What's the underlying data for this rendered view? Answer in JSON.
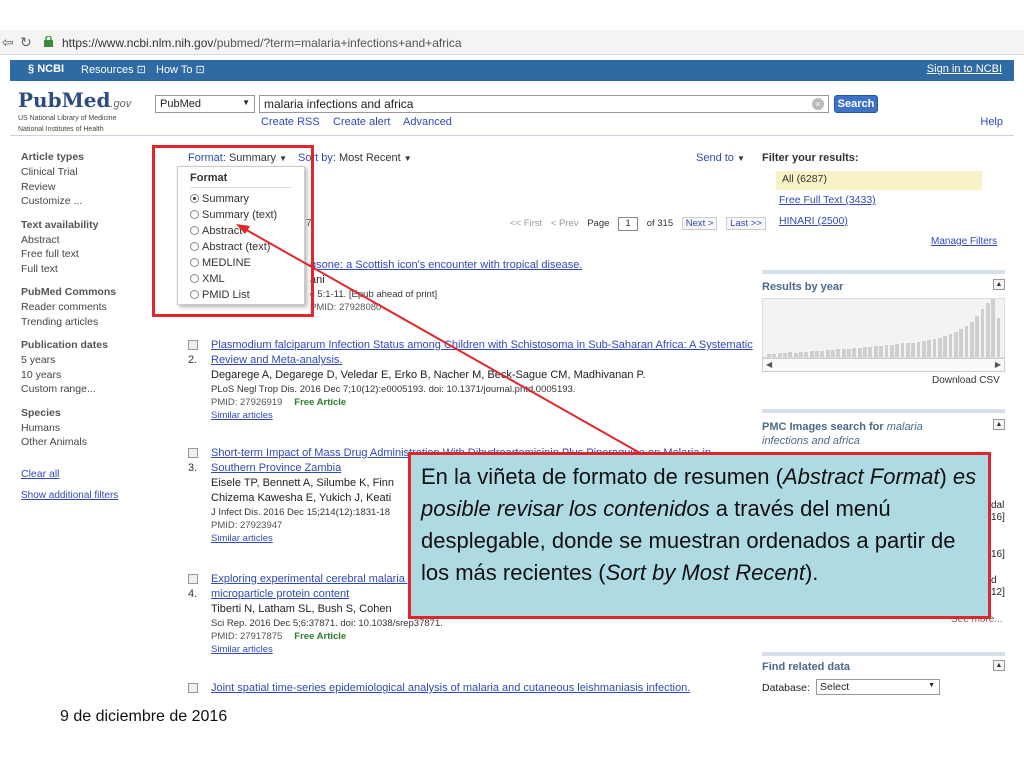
{
  "browser": {
    "url_host": "https://www.ncbi.nlm.nih.gov",
    "url_path": "/pubmed/?term=malaria+infections+and+africa"
  },
  "ncbi_bar": {
    "logo": "NCBI",
    "resources": "Resources",
    "howto": "How To",
    "signin": "Sign in to NCBI"
  },
  "header": {
    "logo_pub": "Pub",
    "logo_med": "Med",
    "logo_gov": ".gov",
    "logo_sub1": "US National Library of Medicine",
    "logo_sub2": "National Institutes of Health",
    "db": "PubMed",
    "query": "malaria infections and africa",
    "search": "Search",
    "create_rss": "Create RSS",
    "create_alert": "Create alert",
    "advanced": "Advanced",
    "help": "Help"
  },
  "sidebar": {
    "groups": [
      {
        "heading": "Article types",
        "items": [
          "Clinical Trial",
          "Review",
          "Customize ..."
        ]
      },
      {
        "heading": "Text availability",
        "items": [
          "Abstract",
          "Free full text",
          "Full text"
        ]
      },
      {
        "heading": "PubMed Commons",
        "items": [
          "Reader comments",
          "Trending articles"
        ]
      },
      {
        "heading": "Publication dates",
        "items": [
          "5 years",
          "10 years",
          "Custom range..."
        ]
      },
      {
        "heading": "Species",
        "items": [
          "Humans",
          "Other Animals"
        ]
      }
    ],
    "clear_all": "Clear all",
    "show_filters": "Show additional filters"
  },
  "toolbar": {
    "format_label": "Format:",
    "format_value": "Summary",
    "sort_label": "Sort by:",
    "sort_value": "Most Recent",
    "send_to": "Send to"
  },
  "format_menu": {
    "heading": "Format",
    "options": [
      "Summary",
      "Summary (text)",
      "Abstract",
      "Abstract (text)",
      "MEDLINE",
      "XML",
      "PMID List"
    ],
    "selected": "Summary"
  },
  "pager": {
    "first": "<< First",
    "prev": "< Prev",
    "page_label": "Page",
    "page": "1",
    "of": "of 315",
    "next": "Next >",
    "last": "Last >>",
    "items_partial": "7"
  },
  "results": [
    {
      "num": "",
      "title": "gsone: a Scottish icon's encounter with tropical disease.",
      "authors": "ani",
      "cite": "c 5:1-11. [Epub ahead of print]",
      "pmid": "PMID: 27928080",
      "free": "",
      "similar": ""
    },
    {
      "num": "2.",
      "title": "Plasmodium falciparum Infection Status among Children with Schistosoma in Sub-Saharan Africa: A Systematic Review and Meta-analysis.",
      "authors": "Degarege A, Degarege D, Veledar E, Erko B, Nacher M, Beck-Sague CM, Madhivanan P.",
      "cite": "PLoS Negl Trop Dis. 2016 Dec 7;10(12):e0005193. doi: 10.1371/journal.pntd.0005193.",
      "pmid": "PMID: 27926919",
      "free": "Free Article",
      "similar": "Similar articles"
    },
    {
      "num": "3.",
      "title": "Short-term Impact of Mass Drug Administration With Dihydroartemisinin Plus Piperaquine on Malaria in Southern Province Zambia",
      "authors": "Eisele TP, Bennett A, Silumbe K, Finn",
      "authors2": "Chizema Kawesha E, Yukich J, Keati",
      "cite": "J Infect Dis. 2016 Dec 15;214(12):1831-18",
      "pmid": "PMID: 27923947",
      "free": "",
      "similar": "Similar articles"
    },
    {
      "num": "4.",
      "title": "Exploring experimental cerebral malaria pathogenesis through the characterisation of host-derived plasma microparticle protein content",
      "authors": "Tiberti N, Latham SL, Bush S, Cohen",
      "cite": "Sci Rep. 2016 Dec 5;6:37871. doi: 10.1038/srep37871.",
      "pmid": "PMID: 27917875",
      "free": "Free Article",
      "similar": "Similar articles"
    },
    {
      "num": "",
      "title": "Joint spatial time-series epidemiological analysis of malaria and cutaneous leishmaniasis infection.",
      "authors": "",
      "cite": "",
      "pmid": "",
      "free": "",
      "similar": ""
    }
  ],
  "right_panel": {
    "filter_heading": "Filter your results:",
    "all": "All (6287)",
    "free_full": "Free Full Text (3433)",
    "hinari": "HINARI (2500)",
    "manage": "Manage Filters",
    "results_by_year": "Results by year",
    "download_csv": "Download CSV",
    "pmc_images": "PMC Images search for",
    "pmc_query": "malaria infections and africa",
    "see_more": "See more...",
    "find_related": "Find related data",
    "database_label": "Database:",
    "database_value": "Select",
    "partial1": "dal",
    "partial2": "16]",
    "partial3": "16]",
    "partial4": "d",
    "partial5": "12]"
  },
  "histogram": [
    3,
    3,
    4,
    4,
    5,
    4,
    5,
    5,
    6,
    6,
    6,
    7,
    7,
    8,
    8,
    8,
    9,
    9,
    10,
    10,
    11,
    11,
    12,
    12,
    13,
    14,
    14,
    15,
    16,
    17,
    18,
    19,
    20,
    22,
    24,
    26,
    29,
    32,
    36,
    42,
    50,
    56,
    60,
    40
  ],
  "callout": {
    "p1": "En la viñeta de formato de resumen (",
    "i1": "Abstract Format",
    "p2": ") ",
    "i2": "es posible revisar los contenidos",
    "p3": " a través del menú desplegable, donde se muestran ordenados a partir de los más recientes (",
    "i3": "Sort by Most Recent",
    "p4": ")."
  },
  "footer_date": "9 de diciembre de 2016",
  "colors": {
    "ncbi_blue": "#2f6aa5",
    "link": "#2f4bb5",
    "highlight_red": "#e0262a",
    "callout_bg": "#aedae4",
    "filter_bg": "#f8f3c7"
  }
}
